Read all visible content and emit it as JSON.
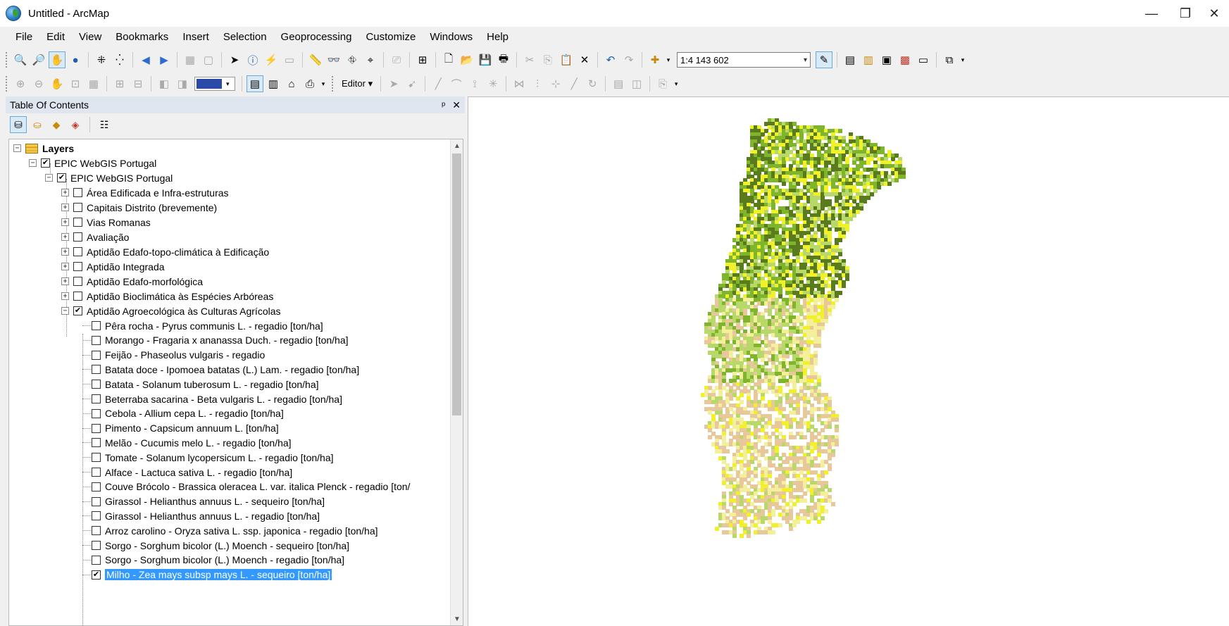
{
  "window": {
    "title": "Untitled - ArcMap",
    "icon": "arcmap-globe-icon",
    "controls": {
      "minimize": "—",
      "maximize": "❐",
      "close": "✕"
    }
  },
  "menu": [
    "File",
    "Edit",
    "View",
    "Bookmarks",
    "Insert",
    "Selection",
    "Geoprocessing",
    "Customize",
    "Windows",
    "Help"
  ],
  "toolbar1": {
    "scale": "1:4 143 602"
  },
  "toolbar2": {
    "editor_label": "Editor ▾"
  },
  "toc": {
    "title": "Table Of Contents",
    "pin": "ᵖ",
    "close": "✕",
    "root": "Layers",
    "group1": "EPIC WebGIS Portugal",
    "group2": "EPIC WebGIS Portugal",
    "groups": [
      {
        "label": "Área Edificada e Infra-estruturas",
        "checked": false,
        "expander": "+"
      },
      {
        "label": "Capitais Distrito (brevemente)",
        "checked": false,
        "expander": "+"
      },
      {
        "label": "Vias Romanas",
        "checked": false,
        "expander": "+"
      },
      {
        "label": "Avaliação",
        "checked": false,
        "expander": "+"
      },
      {
        "label": "Aptidão Edafo-topo-climática à Edificação",
        "checked": false,
        "expander": "+"
      },
      {
        "label": "Aptidão Integrada",
        "checked": false,
        "expander": "+"
      },
      {
        "label": "Aptidão Edafo-morfológica",
        "checked": false,
        "expander": "+"
      },
      {
        "label": "Aptidão Bioclimática às Espécies Arbóreas",
        "checked": false,
        "expander": "+"
      },
      {
        "label": "Aptidão Agroecológica às Culturas Agrícolas",
        "checked": true,
        "expander": "−"
      }
    ],
    "crops": [
      {
        "label": "Pêra rocha - Pyrus communis L. - regadio [ton/ha]",
        "checked": false
      },
      {
        "label": "Morango - Fragaria x ananassa Duch. - regadio [ton/ha]",
        "checked": false
      },
      {
        "label": "Feijão - Phaseolus vulgaris - regadio",
        "checked": false
      },
      {
        "label": "Batata doce - Ipomoea batatas (L.) Lam. - regadio [ton/ha]",
        "checked": false
      },
      {
        "label": "Batata - Solanum tuberosum L. - regadio [ton/ha]",
        "checked": false
      },
      {
        "label": "Beterraba sacarina - Beta vulgaris L.  - regadio [ton/ha]",
        "checked": false
      },
      {
        "label": "Cebola - Allium cepa L. - regadio [ton/ha]",
        "checked": false
      },
      {
        "label": "Pimento - Capsicum annuum L. [ton/ha]",
        "checked": false
      },
      {
        "label": "Melão - Cucumis melo L. - regadio [ton/ha]",
        "checked": false
      },
      {
        "label": "Tomate - Solanum lycopersicum L. - regadio [ton/ha]",
        "checked": false
      },
      {
        "label": "Alface - Lactuca sativa L. - regadio [ton/ha]",
        "checked": false
      },
      {
        "label": "Couve Brócolo - Brassica oleracea L. var. italica Plenck - regadio [ton/",
        "checked": false
      },
      {
        "label": "Girassol - Helianthus annuus L. - sequeiro [ton/ha]",
        "checked": false
      },
      {
        "label": "Girassol - Helianthus annuus L. - regadio [ton/ha]",
        "checked": false
      },
      {
        "label": "Arroz carolino - Oryza sativa L. ssp. japonica - regadio [ton/ha]",
        "checked": false
      },
      {
        "label": "Sorgo - Sorghum bicolor (L.) Moench - sequeiro [ton/ha]",
        "checked": false
      },
      {
        "label": "Sorgo - Sorghum bicolor (L.) Moench - regadio [ton/ha]",
        "checked": false
      },
      {
        "label": "Milho - Zea mays subsp mays L. - sequeiro [ton/ha]",
        "checked": true,
        "selected": true
      }
    ]
  },
  "map": {
    "palette": {
      "dark_green": "#5a7a1e",
      "green": "#7fb52a",
      "light_green": "#b9d86a",
      "yellow": "#f1f12a",
      "pale_yellow": "#f3ef9a",
      "tan": "#e8c79a"
    }
  }
}
